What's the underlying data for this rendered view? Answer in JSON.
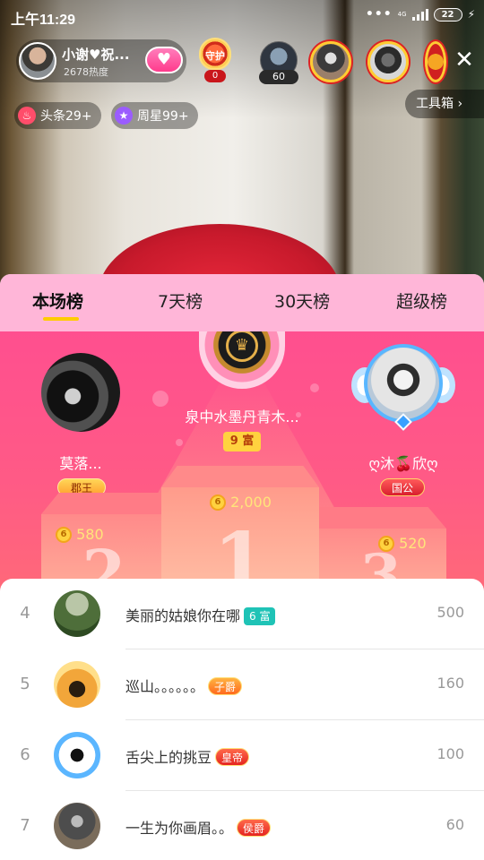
{
  "status_bar": {
    "time": "上午11:29",
    "network": "4G",
    "battery": "22"
  },
  "live_header": {
    "host_name": "小谢♥祝...",
    "host_heat": "2678热度",
    "guard_label": "守护",
    "guard_count": "0",
    "viewer_count": "60"
  },
  "chips": {
    "hot_label": "头条29+",
    "star_label": "周星99+",
    "toolbox_label": "工具箱 ›"
  },
  "tabs": [
    {
      "label": "本场榜",
      "active": true
    },
    {
      "label": "7天榜",
      "active": false
    },
    {
      "label": "30天榜",
      "active": false
    },
    {
      "label": "超级榜",
      "active": false
    }
  ],
  "podium": {
    "first": {
      "name": "泉中水墨丹青木...",
      "badge": "9 富",
      "score": "2,000"
    },
    "second": {
      "name": "莫落...",
      "badge": "郡王",
      "score": "580"
    },
    "third": {
      "name": "ღ沐🍒欣ღ",
      "badge": "国公",
      "score": "520"
    },
    "stage_numbers": [
      "1",
      "2",
      "3"
    ]
  },
  "ranking_list": [
    {
      "rank": "4",
      "name": "美丽的姑娘你在哪",
      "badge": "6 富",
      "badge_style": "teal",
      "score": "500"
    },
    {
      "rank": "5",
      "name": "巡山。。。。。。",
      "badge": "子爵",
      "badge_style": "gold",
      "score": "160"
    },
    {
      "rank": "6",
      "name": "舌尖上的挑豆",
      "badge": "皇帝",
      "badge_style": "red",
      "score": "100"
    },
    {
      "rank": "7",
      "name": "一生为你画眉。。",
      "badge": "侯爵",
      "badge_style": "red",
      "score": "60"
    }
  ],
  "colors": {
    "tab_bar": "#ffb6d8",
    "podium_bg": "#ff4f8f",
    "tab_underline": "#ffcc00",
    "score_text": "#ffe57a"
  },
  "icons": {
    "close": "close-icon",
    "heart": "heart-icon",
    "hot": "flame-icon",
    "star": "star-icon",
    "coin": "coin-icon"
  }
}
